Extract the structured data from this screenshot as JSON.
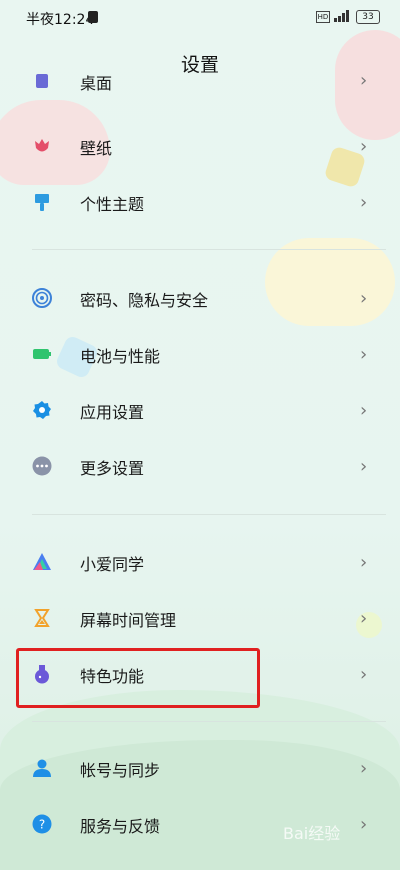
{
  "status_bar": {
    "time": "半夜12:24",
    "battery": "33"
  },
  "header": {
    "title": "设置"
  },
  "rows": [
    {
      "label": "桌面",
      "icon": "desktop-icon",
      "color": "#6a6ad6"
    },
    {
      "label": "壁纸",
      "icon": "tulip-icon",
      "color": "#e44f6a"
    },
    {
      "label": "个性主题",
      "icon": "brush-icon",
      "color": "#2d9be0"
    },
    {
      "label": "密码、隐私与安全",
      "icon": "fingerprint-icon",
      "color": "#3d82d8"
    },
    {
      "label": "电池与性能",
      "icon": "battery-icon",
      "color": "#2fc46e"
    },
    {
      "label": "应用设置",
      "icon": "gear-icon",
      "color": "#1a8fe3"
    },
    {
      "label": "更多设置",
      "icon": "more-icon",
      "color": "#8a93a8"
    },
    {
      "label": "小爱同学",
      "icon": "xiaoai-icon",
      "color": "#4a7ef0"
    },
    {
      "label": "屏幕时间管理",
      "icon": "hourglass-icon",
      "color": "#f2a22b"
    },
    {
      "label": "特色功能",
      "icon": "flask-icon",
      "color": "#6b59d8"
    },
    {
      "label": "帐号与同步",
      "icon": "user-icon",
      "color": "#1f8fe6"
    },
    {
      "label": "服务与反馈",
      "icon": "help-icon",
      "color": "#1f8fe6"
    }
  ],
  "watermark": "Bai经验"
}
